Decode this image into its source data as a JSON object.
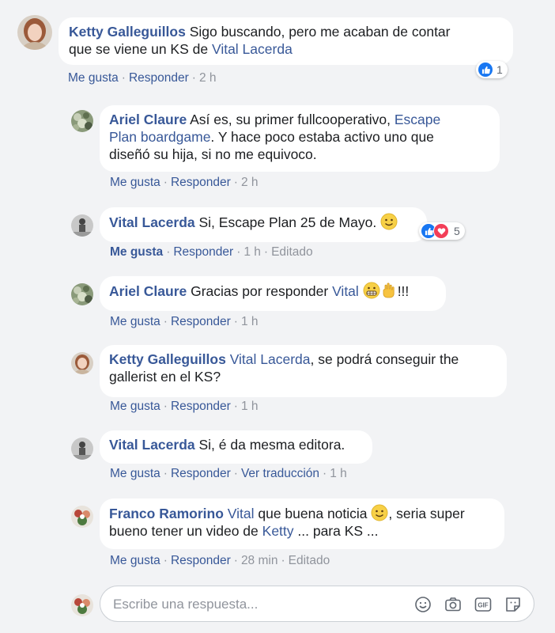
{
  "comments": [
    {
      "author": "Ketty Galleguillos",
      "text_1": "Sigo buscando, pero me acaban de contar",
      "text_2": "que se viene un KS de ",
      "link_1": "Vital Lacerda",
      "like": "Me gusta",
      "reply": "Responder",
      "time": "2 h",
      "reaction_count": "1"
    },
    {
      "author": "Ariel Claure",
      "text_1": " Así es, su primer fullcooperativo, ",
      "link_1": "Escape",
      "link_2": "Plan boardgame",
      "text_2": ". Y hace poco estaba activo uno que",
      "text_3": "diseñó su hija, si no me equivoco.",
      "like": "Me gusta",
      "reply": "Responder",
      "time": "2 h"
    },
    {
      "author": "Vital Lacerda",
      "text_1": " Si, Escape Plan 25 de Mayo. ",
      "like": "Me gusta",
      "reply": "Responder",
      "time": "1 h",
      "edited": "Editado",
      "reaction_count": "5"
    },
    {
      "author": "Ariel Claure",
      "text_1": " Gracias por responder ",
      "link_1": "Vital",
      "text_2": "!!!",
      "like": "Me gusta",
      "reply": "Responder",
      "time": "1 h"
    },
    {
      "author": "Ketty Galleguillos",
      "link_1": "Vital Lacerda",
      "text_1": ", se podrá conseguir the",
      "text_2": "gallerist en el KS?",
      "like": "Me gusta",
      "reply": "Responder",
      "time": "1 h"
    },
    {
      "author": "Vital Lacerda",
      "text_1": " Si, é da mesma editora.",
      "like": "Me gusta",
      "reply": "Responder",
      "translate": "Ver traducción",
      "time": "1 h"
    },
    {
      "author": "Franco Ramorino",
      "link_1": "Vital",
      "text_1": " que buena noticia ",
      "text_2": ", seria super",
      "text_3": "bueno tener un video de ",
      "link_2": "Ketty",
      "text_4": " ... para KS ...",
      "like": "Me gusta",
      "reply": "Responder",
      "time": "28 min",
      "edited": "Editado"
    }
  ],
  "reply_box": {
    "placeholder": "Escribe una respuesta..."
  },
  "colors": {
    "link": "#385898",
    "like_blue": "#1877f2",
    "love_red": "#f33e58",
    "background": "#f2f3f5"
  },
  "icons": [
    "thumbs-up-icon",
    "heart-icon",
    "smile-emoji-icon",
    "grimace-emoji-icon",
    "pointing-hand-emoji-icon",
    "emoji-icon",
    "camera-icon",
    "gif-icon",
    "sticker-icon"
  ]
}
